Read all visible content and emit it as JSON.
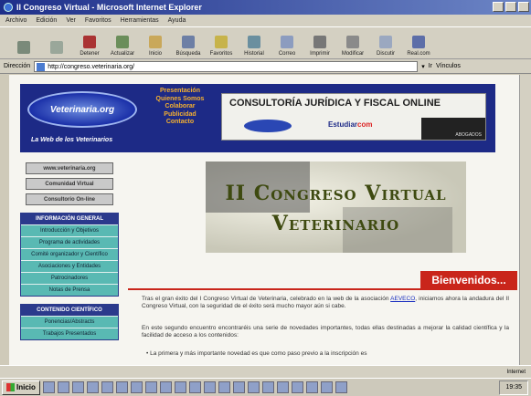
{
  "window": {
    "title": "II Congreso Virtual - Microsoft Internet Explorer"
  },
  "menu": [
    "Archivo",
    "Edición",
    "Ver",
    "Favoritos",
    "Herramientas",
    "Ayuda"
  ],
  "toolbar": [
    {
      "label": "",
      "icon": "back-icon"
    },
    {
      "label": "",
      "icon": "forward-icon"
    },
    {
      "label": "Detener",
      "icon": "stop-icon"
    },
    {
      "label": "Actualizar",
      "icon": "refresh-icon"
    },
    {
      "label": "Inicio",
      "icon": "home-icon"
    },
    {
      "label": "Búsqueda",
      "icon": "search-icon"
    },
    {
      "label": "Favoritos",
      "icon": "favorites-icon"
    },
    {
      "label": "Historial",
      "icon": "history-icon"
    },
    {
      "label": "Correo",
      "icon": "mail-icon"
    },
    {
      "label": "Imprimir",
      "icon": "print-icon"
    },
    {
      "label": "Modificar",
      "icon": "edit-icon"
    },
    {
      "label": "Discutir",
      "icon": "discuss-icon"
    },
    {
      "label": "Real.com",
      "icon": "realcom-icon"
    }
  ],
  "address": {
    "label": "Dirección",
    "url": "http://congreso.veterinaria.org/",
    "go": "Ir",
    "links": "Vínculos"
  },
  "banner": {
    "logo": "Veterinaria.org",
    "tagline": "La Web de los Veterinarios",
    "nav": [
      "Presentación",
      "Quienes Somos",
      "Colaborar",
      "Publicidad",
      "Contacto"
    ],
    "ad_title": "CONSULTORÍA JURÍDICA Y FISCAL ONLINE",
    "ad_brand": "Estudiar",
    "ad_brand2": "com",
    "ad_dark": "ABOGADOS"
  },
  "sidebar": {
    "top_buttons": [
      "www.veterinaria.org",
      "Comunidad Virtual",
      "Consultorio On-line"
    ],
    "sections": [
      {
        "title": "INFORMACIÓN GENERAL",
        "items": [
          "Introducción y Objetivos",
          "Programa de actividades",
          "Comité organizador y Científico",
          "Asociaciones y Entidades",
          "Patrocinadores",
          "Notas de Prensa"
        ]
      },
      {
        "title": "CONTENIDO CIENTÍFICO",
        "items": [
          "Ponencias/Abstracts",
          "Trabajos Presentados"
        ]
      }
    ]
  },
  "hero": {
    "line1": "II Congreso Virtual",
    "line2": "Veterinario"
  },
  "welcome": "Bienvenidos...",
  "body": {
    "p1_a": "Tras el gran éxito del I Congreso Virtual de Veterinaria, celebrado en la web de la asociación",
    "p1_link": "AEVECO",
    "p1_b": ", iniciamos ahora la andadura del II Congreso Virtual, con la seguridad de el éxito será mucho mayor aún si cabe.",
    "p2": "En este segundo encuentro encontraréis una serie de novedades importantes, todas ellas destinadas a mejorar la calidad científica y la facilidad de acceso a los contenidos:",
    "bullet": "• La primera y más importante novedad es que como paso previo a la inscripción es"
  },
  "status": {
    "text": "",
    "zone": "Internet"
  },
  "taskbar": {
    "start": "Inicio",
    "clock": "19:35"
  }
}
